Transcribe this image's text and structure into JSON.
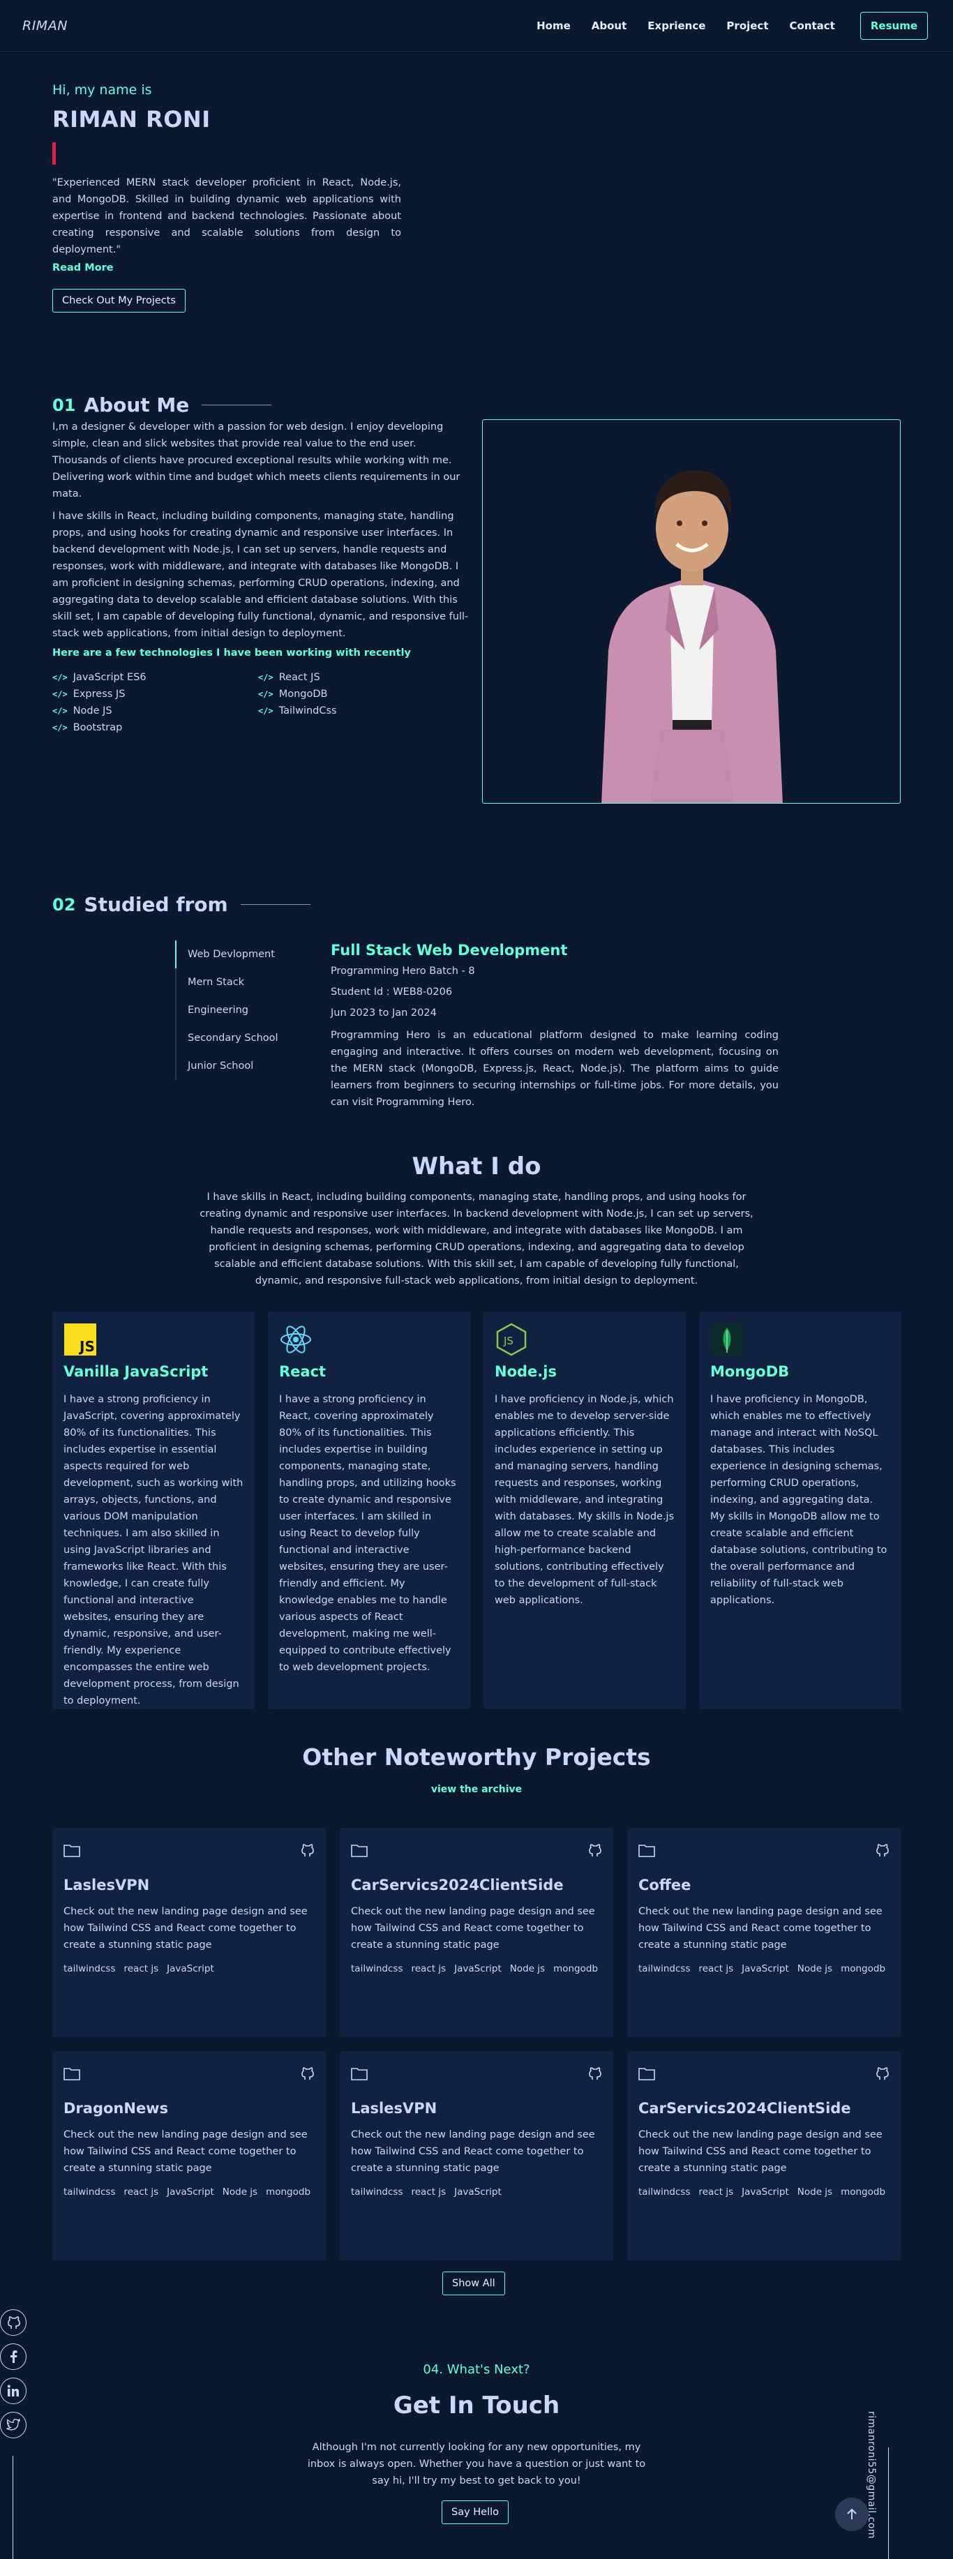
{
  "nav": {
    "logo": "RIMAN",
    "links": [
      "Home",
      "About",
      "Exprience",
      "Project",
      "Contact"
    ],
    "resume": "Resume"
  },
  "hero": {
    "greeting": "Hi, my name is",
    "name": "RIMAN RONI",
    "description": "\"Experienced MERN stack developer proficient in React, Node.js, and MongoDB. Skilled in building dynamic web applications with expertise in frontend and backend technologies. Passionate about creating responsive and scalable solutions from design to deployment.\"",
    "read_more": "Read More",
    "cta": "Check Out My Projects"
  },
  "about": {
    "num": "01",
    "title": "About Me",
    "p1": "I,m a designer & developer with a passion for web design. I enjoy developing simple, clean and slick websites that provide real value to the end user. Thousands of clients have procured exceptional results while working with me. Delivering work within time and budget which meets clients requirements in our mata.",
    "p2": "I have skills in React, including building components, managing state, handling props, and using hooks for creating dynamic and responsive user interfaces. In backend development with Node.js, I can set up servers, handle requests and responses, work with middleware, and integrate with databases like MongoDB. I am proficient in designing schemas, performing CRUD operations, indexing, and aggregating data to develop scalable and efficient database solutions. With this skill set, I am capable of developing fully functional, dynamic, and responsive full-stack web applications, from initial design to deployment.",
    "tech_heading": "Here are a few technologies I have been working with recently",
    "technologies": [
      "JavaScript ES6",
      "React JS",
      "Express JS",
      "MongoDB",
      "Node JS",
      "TailwindCss",
      "Bootstrap"
    ]
  },
  "studied": {
    "num": "02",
    "title": "Studied from",
    "tabs": [
      "Web Devlopment",
      "Mern Stack",
      "Engineering",
      "Secondary School",
      "Junior School"
    ],
    "course_title": "Full Stack Web Development",
    "batch": "Programming Hero Batch - 8",
    "student_id": "Student Id : WEB8-0206",
    "duration": "Jun 2023 to Jan 2024",
    "description": "Programming Hero is an educational platform designed to make learning coding engaging and interactive. It offers courses on modern web development, focusing on the MERN stack (MongoDB, Express.js, React, Node.js). The platform aims to guide learners from beginners to securing internships or full-time jobs. For more details, you can visit Programming Hero."
  },
  "whatido": {
    "title": "What I do",
    "description": "I have skills in React, including building components, managing state, handling props, and using hooks for creating dynamic and responsive user interfaces. In backend development with Node.js, I can set up servers, handle requests and responses, work with middleware, and integrate with databases like MongoDB. I am proficient in designing schemas, performing CRUD operations, indexing, and aggregating data to develop scalable and efficient database solutions. With this skill set, I am capable of developing fully functional, dynamic, and responsive full-stack web applications, from initial design to deployment.",
    "cards": [
      {
        "title": "Vanilla JavaScript",
        "icon": "javascript-logo",
        "text": "I have a strong proficiency in JavaScript, covering approximately 80% of its functionalities. This includes expertise in essential aspects required for web development, such as working with arrays, objects, functions, and various DOM manipulation techniques. I am also skilled in using JavaScript libraries and frameworks like React. With this knowledge, I can create fully functional and interactive websites, ensuring they are dynamic, responsive, and user-friendly. My experience encompasses the entire web development process, from design to deployment."
      },
      {
        "title": "React",
        "icon": "react-logo",
        "text": "I have a strong proficiency in React, covering approximately 80% of its functionalities. This includes expertise in building components, managing state, handling props, and utilizing hooks to create dynamic and responsive user interfaces. I am skilled in using React to develop fully functional and interactive websites, ensuring they are user-friendly and efficient. My knowledge enables me to handle various aspects of React development, making me well-equipped to contribute effectively to web development projects."
      },
      {
        "title": "Node.js",
        "icon": "nodejs-logo",
        "text": "I have proficiency in Node.js, which enables me to develop server-side applications efficiently. This includes experience in setting up and managing servers, handling requests and responses, working with middleware, and integrating with databases. My skills in Node.js allow me to create scalable and high-performance backend solutions, contributing effectively to the development of full-stack web applications."
      },
      {
        "title": "MongoDB",
        "icon": "mongodb-logo",
        "text": "I have proficiency in MongoDB, which enables me to effectively manage and interact with NoSQL databases. This includes experience in designing schemas, performing CRUD operations, indexing, and aggregating data. My skills in MongoDB allow me to create scalable and efficient database solutions, contributing to the overall performance and reliability of full-stack web applications."
      }
    ]
  },
  "projects": {
    "title": "Other Noteworthy Projects",
    "archive": "view the archive",
    "items": [
      {
        "title": "LaslesVPN",
        "desc": "Check out the new landing page design and see how Tailwind CSS and React come together to create a stunning static page",
        "tags": [
          "tailwindcss",
          "react js",
          "JavaScript"
        ]
      },
      {
        "title": "CarServics2024ClientSide",
        "desc": "Check out the new landing page design and see how Tailwind CSS and React come together to create a stunning static page",
        "tags": [
          "tailwindcss",
          "react js",
          "JavaScript",
          "Node js",
          "mongodb"
        ]
      },
      {
        "title": "Coffee",
        "desc": "Check out the new landing page design and see how Tailwind CSS and React come together to create a stunning static page",
        "tags": [
          "tailwindcss",
          "react js",
          "JavaScript",
          "Node js",
          "mongodb"
        ]
      },
      {
        "title": "DragonNews",
        "desc": "Check out the new landing page design and see how Tailwind CSS and React come together to create a stunning static page",
        "tags": [
          "tailwindcss",
          "react js",
          "JavaScript",
          "Node js",
          "mongodb"
        ]
      },
      {
        "title": "LaslesVPN",
        "desc": "Check out the new landing page design and see how Tailwind CSS and React come together to create a stunning static page",
        "tags": [
          "tailwindcss",
          "react js",
          "JavaScript"
        ]
      },
      {
        "title": "CarServics2024ClientSide",
        "desc": "Check out the new landing page design and see how Tailwind CSS and React come together to create a stunning static page",
        "tags": [
          "tailwindcss",
          "react js",
          "JavaScript",
          "Node js",
          "mongodb"
        ]
      }
    ],
    "show_all": "Show All"
  },
  "contact": {
    "next": "04. What's Next?",
    "title": "Get In Touch",
    "description": "Although I'm not currently looking for any new opportunities, my inbox is always open. Whether you have a question or just want to say hi, I'll try my best to get back to you!",
    "button": "Say Hello",
    "email": "rimanroni55@gmail.com"
  },
  "social": [
    "github-icon",
    "facebook-icon",
    "linkedin-icon",
    "twitter-icon"
  ],
  "colors": {
    "bg": "#0a192f",
    "card": "#112240",
    "accent": "#64ffda",
    "text": "#ccd6f6"
  }
}
